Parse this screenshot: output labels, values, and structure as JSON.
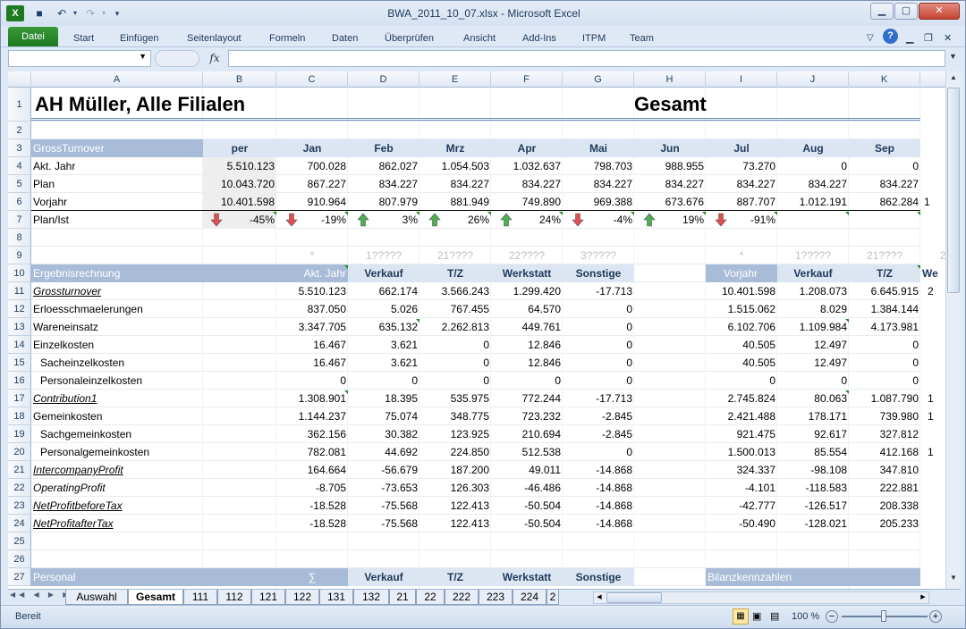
{
  "window": {
    "title": "BWA_2011_10_07.xlsx - Microsoft Excel"
  },
  "ribbon": {
    "tabs": [
      "Datei",
      "Start",
      "Einfügen",
      "Seitenlayout",
      "Formeln",
      "Daten",
      "Überprüfen",
      "Ansicht",
      "Add-Ins",
      "ITPM",
      "Team"
    ]
  },
  "formula_bar": {
    "name_box": "",
    "fx": "fx",
    "formula": ""
  },
  "columns": [
    "A",
    "B",
    "C",
    "D",
    "E",
    "F",
    "G",
    "H",
    "I",
    "J",
    "K"
  ],
  "rows": [
    "1",
    "2",
    "3",
    "4",
    "5",
    "6",
    "7",
    "8",
    "9",
    "10",
    "11",
    "12",
    "13",
    "14",
    "15",
    "16",
    "17",
    "18",
    "19",
    "20",
    "21",
    "22",
    "23",
    "24",
    "25",
    "26",
    "27"
  ],
  "sheet": {
    "title_left": "AH Müller, Alle Filialen",
    "title_right": "Gesamt",
    "r3": [
      "GrossTurnover",
      "per",
      "Jan",
      "Feb",
      "Mrz",
      "Apr",
      "Mai",
      "Jun",
      "Jul",
      "Aug",
      "Sep"
    ],
    "r4": [
      "Akt. Jahr",
      "5.510.123",
      "700.028",
      "862.027",
      "1.054.503",
      "1.032.637",
      "798.703",
      "988.955",
      "73.270",
      "0",
      "0"
    ],
    "r5": [
      "Plan",
      "10.043.720",
      "867.227",
      "834.227",
      "834.227",
      "834.227",
      "834.227",
      "834.227",
      "834.227",
      "834.227",
      "834.227"
    ],
    "r6": [
      "Vorjahr",
      "10.401.598",
      "910.964",
      "807.979",
      "881.949",
      "749.890",
      "969.388",
      "673.676",
      "887.707",
      "1.012.191",
      "862.284"
    ],
    "r6_overflow": "1",
    "r7": [
      "Plan/Ist",
      "-45%",
      "-19%",
      "3%",
      "26%",
      "24%",
      "-4%",
      "19%",
      "-91%"
    ],
    "r9": [
      "*",
      "1?????",
      "21????",
      "22????",
      "3?????",
      "*",
      "1?????",
      "21????",
      "2"
    ],
    "r10": [
      "Ergebnisrechnung",
      "Akt. Jahr",
      "Verkauf",
      "T/Z",
      "Werkstatt",
      "Sonstige",
      "Vorjahr",
      "Verkauf",
      "T/Z",
      "We"
    ],
    "body": [
      [
        "Grossturnover",
        "5.510.123",
        "662.174",
        "3.566.243",
        "1.299.420",
        "-17.713",
        "10.401.598",
        "1.208.073",
        "6.645.915",
        "2"
      ],
      [
        "Erloesschmaelerungen",
        "837.050",
        "5.026",
        "767.455",
        "64.570",
        "0",
        "1.515.062",
        "8.029",
        "1.384.144",
        ""
      ],
      [
        "Wareneinsatz",
        "3.347.705",
        "635.132",
        "2.262.813",
        "449.761",
        "0",
        "6.102.706",
        "1.109.984",
        "4.173.981",
        ""
      ],
      [
        "Einzelkosten",
        "16.467",
        "3.621",
        "0",
        "12.846",
        "0",
        "40.505",
        "12.497",
        "0",
        ""
      ],
      [
        "Sacheinzelkosten",
        "16.467",
        "3.621",
        "0",
        "12.846",
        "0",
        "40.505",
        "12.497",
        "0",
        ""
      ],
      [
        "Personaleinzelkosten",
        "0",
        "0",
        "0",
        "0",
        "0",
        "0",
        "0",
        "0",
        ""
      ],
      [
        "Contribution1",
        "1.308.901",
        "18.395",
        "535.975",
        "772.244",
        "-17.713",
        "2.745.824",
        "80.063",
        "1.087.790",
        "1"
      ],
      [
        "Gemeinkosten",
        "1.144.237",
        "75.074",
        "348.775",
        "723.232",
        "-2.845",
        "2.421.488",
        "178.171",
        "739.980",
        "1"
      ],
      [
        "Sachgemeinkosten",
        "362.156",
        "30.382",
        "123.925",
        "210.694",
        "-2.845",
        "921.475",
        "92.617",
        "327.812",
        ""
      ],
      [
        "Personalgemeinkosten",
        "782.081",
        "44.692",
        "224.850",
        "512.538",
        "0",
        "1.500.013",
        "85.554",
        "412.168",
        "1"
      ],
      [
        "IntercompanyProfit",
        "164.664",
        "-56.679",
        "187.200",
        "49.011",
        "-14.868",
        "324.337",
        "-98.108",
        "347.810",
        ""
      ],
      [
        "OperatingProfit",
        "-8.705",
        "-73.653",
        "126.303",
        "-46.486",
        "-14.868",
        "-4.101",
        "-118.583",
        "222.881",
        ""
      ],
      [
        "NetProfitbeforeTax",
        "-18.528",
        "-75.568",
        "122.413",
        "-50.504",
        "-14.868",
        "-42.777",
        "-126.517",
        "208.338",
        ""
      ],
      [
        "NetProfitafterTax",
        "-18.528",
        "-75.568",
        "122.413",
        "-50.504",
        "-14.868",
        "-50.490",
        "-128.021",
        "205.233",
        ""
      ]
    ],
    "r27": [
      "Personal",
      "∑",
      "Verkauf",
      "T/Z",
      "Werkstatt",
      "Sonstige",
      "Bilanzkennzahlen"
    ]
  },
  "sheet_tabs": [
    "Auswahl",
    "Gesamt",
    "111",
    "112",
    "121",
    "122",
    "131",
    "132",
    "21",
    "22",
    "222",
    "223",
    "224",
    "2"
  ],
  "active_sheet": "Gesamt",
  "status": {
    "ready": "Bereit",
    "zoom": "100 %"
  },
  "colors": {
    "header_band": "#a8bcd8",
    "accent_green": "#1e7a22",
    "arrow_up": "#4caf50",
    "arrow_down": "#e05050"
  }
}
